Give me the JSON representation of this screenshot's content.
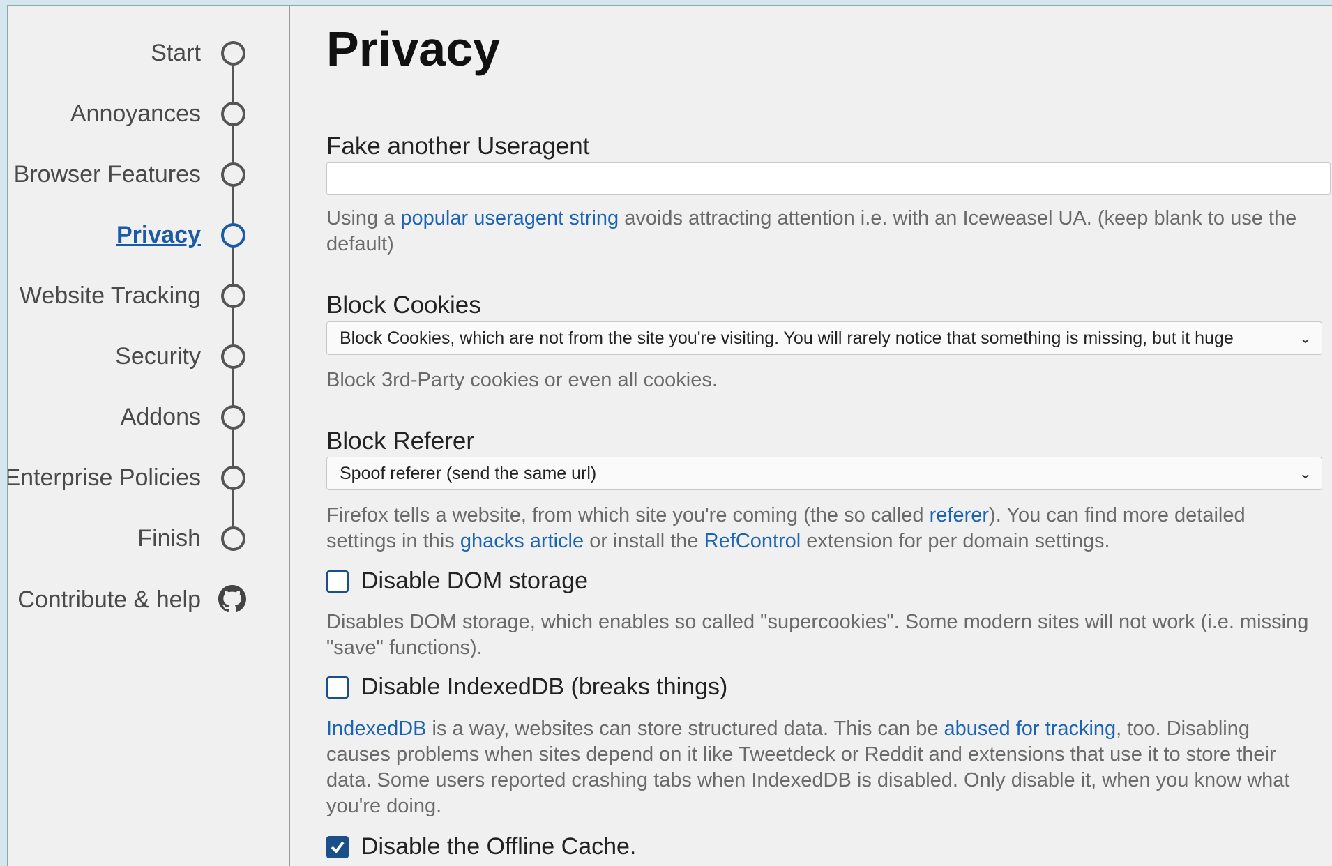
{
  "colors": {
    "accent": "#1b5aa6",
    "link": "#1b64b5",
    "line": "#555555",
    "checkbox": "#1b4f8a"
  },
  "sidebar": {
    "items": [
      {
        "label": "Start",
        "active": false
      },
      {
        "label": "Annoyances",
        "active": false
      },
      {
        "label": "Browser Features",
        "active": false
      },
      {
        "label": "Privacy",
        "active": true
      },
      {
        "label": "Website Tracking",
        "active": false
      },
      {
        "label": "Security",
        "active": false
      },
      {
        "label": "Addons",
        "active": false
      },
      {
        "label": "Enterprise Policies",
        "active": false
      },
      {
        "label": "Finish",
        "active": false
      }
    ],
    "help": {
      "label": "Contribute & help",
      "icon": "github-icon"
    }
  },
  "main": {
    "title": "Privacy",
    "useragent": {
      "label": "Fake another Useragent",
      "value": "",
      "desc_pre": "Using a ",
      "desc_link": "popular useragent string",
      "desc_post": " avoids attracting attention i.e. with an Iceweasel UA. (keep blank to use the default)"
    },
    "cookies": {
      "label": "Block Cookies",
      "selected": "Block Cookies, which are not from the site you're visiting. You will rarely notice that something is missing, but it huge",
      "desc": "Block 3rd-Party cookies or even all cookies."
    },
    "referer": {
      "label": "Block Referer",
      "selected": "Spoof referer (send the same url)",
      "desc_1": "Firefox tells a website, from which site you're coming (the so called ",
      "link_1": "referer",
      "desc_2": "). You can find more detailed settings in this ",
      "link_2": "ghacks article",
      "desc_3": " or install the ",
      "link_3": "RefControl",
      "desc_4": " extension for per domain settings."
    },
    "dom_storage": {
      "label": "Disable DOM storage",
      "checked": false,
      "desc": "Disables DOM storage, which enables so called \"supercookies\". Some modern sites will not work (i.e. missing \"save\" functions)."
    },
    "indexeddb": {
      "label": "Disable IndexedDB (breaks things)",
      "checked": false,
      "link_1": "IndexedDB",
      "desc_1": " is a way, websites can store structured data. This can be ",
      "link_2": "abused for tracking",
      "desc_2": ", too. Disabling causes problems when sites depend on it like Tweetdeck or Reddit and extensions that use it to store their data. Some users reported crashing tabs when IndexedDB is disabled. Only disable it, when you know what you're doing."
    },
    "offline_cache": {
      "label": "Disable the Offline Cache.",
      "checked": true
    }
  }
}
